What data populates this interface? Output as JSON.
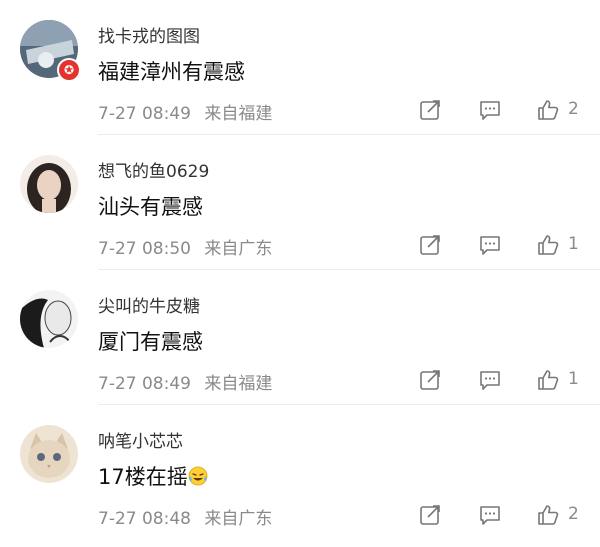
{
  "comments": [
    {
      "username": "找卡戎的图图",
      "text": "福建漳州有震感",
      "time": "7-27 08:49",
      "location": "来自福建",
      "likes": "2",
      "avatar_colors": [
        "#4b5a6a",
        "#9fb0bf"
      ],
      "has_badge": true
    },
    {
      "username": "想飞的鱼0629",
      "text": "汕头有震感",
      "time": "7-27 08:50",
      "location": "来自广东",
      "likes": "1",
      "avatar_colors": [
        "#2b2420",
        "#e8cdbf"
      ],
      "has_badge": false
    },
    {
      "username": "尖叫的牛皮糖",
      "text": "厦门有震感",
      "time": "7-27 08:49",
      "location": "来自福建",
      "likes": "1",
      "avatar_colors": [
        "#1a1a1a",
        "#f2f2f2"
      ],
      "has_badge": false
    },
    {
      "username": "呐笔小芯芯",
      "text": "17楼在摇",
      "text_emoji": "laughing-crying-emoji",
      "time": "7-27 08:48",
      "location": "来自广东",
      "likes": "2",
      "avatar_colors": [
        "#c9b8a3",
        "#f1e6d6"
      ],
      "has_badge": false
    }
  ],
  "colors": {
    "meta_text": "#8a8a8a",
    "badge_red": "#e5322d",
    "divider": "#ececec"
  }
}
